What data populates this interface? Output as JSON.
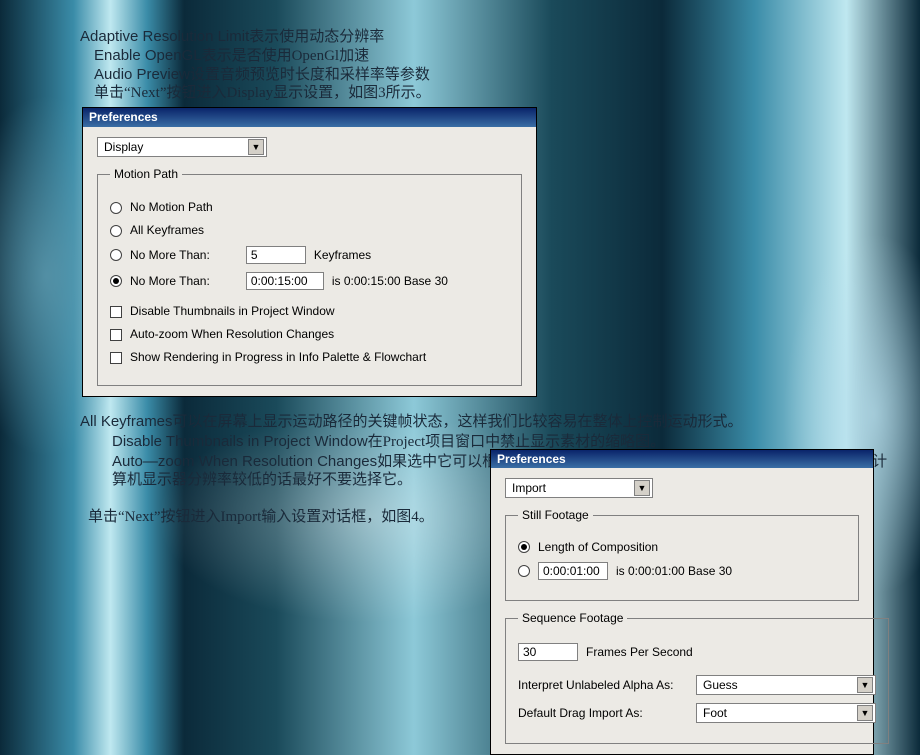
{
  "text": {
    "line1a": "Adaptive Resolution Limit",
    "line1b": "表示使用动态分辨率",
    "line2a": "Enable OpenGL",
    "line2b": "表示是否使用OpenGl加速",
    "line3a": "Audio Preview",
    "line3b": "设置音频预览时长度和采样率等参数",
    "line4": "单击“Next”按钮进入Display显示设置，如图3所示。",
    "para1a": "All Keyframes",
    "para1b": "可以在屏幕上显示运动路径的关键帧状态，这样我们比较容易在整体上控制运动形式。",
    "para2a": "Disable Thumbnails in Project Window",
    "para2b": "在Project项目窗口中禁止显示素材的缩略图。",
    "para3a": "Auto—zoom When Resolution Changes",
    "para3b": "如果选中它可以根据合成窗口的分辨率自动改变合成窗口的大小，如果你的计算机显示器分辨率较低的话最好不要选择它。",
    "para4": "单击“Next”按钮进入Import输入设置对话框，如图4。"
  },
  "dlg1": {
    "title": "Preferences",
    "category": "Display",
    "group1_legend": "Motion Path",
    "r1": "No Motion Path",
    "r2": "All Keyframes",
    "r3": "No More Than:",
    "r3_val": "5",
    "r3_suffix": "Keyframes",
    "r4": "No More Than:",
    "r4_val": "0:00:15:00",
    "r4_suffix": "is 0:00:15:00  Base 30",
    "c1": "Disable Thumbnails in Project Window",
    "c2": "Auto-zoom When Resolution Changes",
    "c3": "Show Rendering in Progress in Info Palette & Flowchart"
  },
  "dlg2": {
    "title": "Preferences",
    "category": "Import",
    "group1_legend": "Still Footage",
    "r1": "Length of Composition",
    "r2_val": "0:00:01:00",
    "r2_suffix": "is 0:00:01:00  Base 30",
    "group2_legend": "Sequence Footage",
    "seq_val": "30",
    "seq_suffix": "Frames Per Second",
    "alpha_label": "Interpret Unlabeled Alpha As:",
    "alpha_val": "Guess",
    "drag_label": "Default Drag Import As:",
    "drag_val": "Foot"
  }
}
